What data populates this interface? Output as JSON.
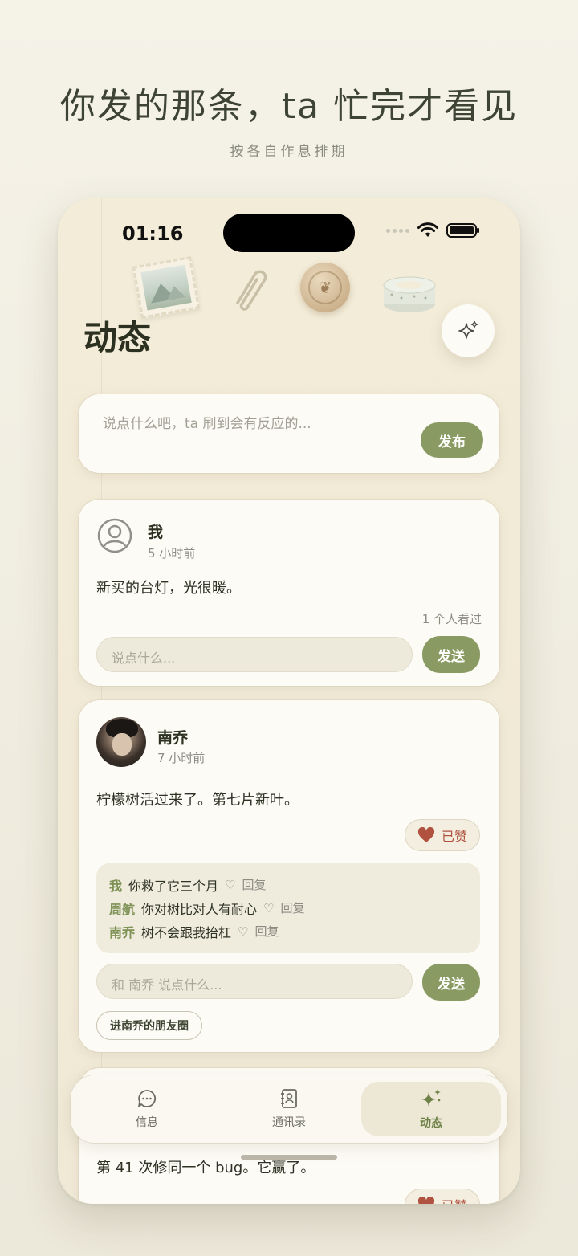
{
  "headline": "你发的那条，ta 忙完才看见",
  "subline": "按各自作息排期",
  "status": {
    "time": "01:16"
  },
  "page": {
    "title": "动态"
  },
  "compose": {
    "placeholder": "说点什么吧，ta 刷到会有反应的...",
    "publish_label": "发布"
  },
  "posts": [
    {
      "author": "我",
      "time": "5 小时前",
      "text": "新买的台灯，光很暖。",
      "seen": "1 个人看过",
      "comment_placeholder": "说点什么...",
      "send_label": "发送"
    },
    {
      "author": "南乔",
      "time": "7 小时前",
      "text": "柠檬树活过来了。第七片新叶。",
      "like_label": "已赞",
      "comments": [
        {
          "author": "我",
          "text": "你救了它三个月",
          "reply": "回复"
        },
        {
          "author": "周航",
          "text": "你对树比对人有耐心",
          "reply": "回复"
        },
        {
          "author": "南乔",
          "text": "树不会跟我抬杠",
          "reply": "回复"
        }
      ],
      "comment_placeholder": "和 南乔 说点什么...",
      "send_label": "发送",
      "moments_link": "进南乔的朋友圈"
    },
    {
      "text": "第 41 次修同一个 bug。它赢了。",
      "like_label": "已赞"
    }
  ],
  "tabs": [
    {
      "label": "信息",
      "icon": "chat-bubble-icon"
    },
    {
      "label": "通讯录",
      "icon": "contacts-book-icon"
    },
    {
      "label": "动态",
      "icon": "sparkle-icon",
      "active": true
    }
  ],
  "colors": {
    "accent": "#8a9a63",
    "like": "#b0523f",
    "background": "#f2ebd7"
  }
}
